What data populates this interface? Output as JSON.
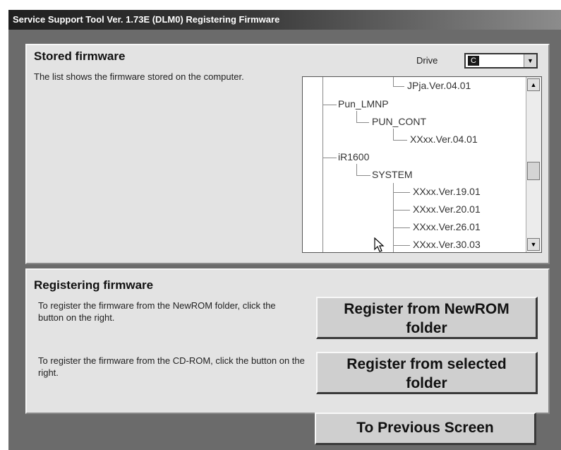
{
  "window": {
    "title": "Service Support Tool Ver. 1.73E (DLM0)   Registering Firmware"
  },
  "stored": {
    "heading": "Stored firmware",
    "description": "The list shows the firmware stored on the computer.",
    "drive_label": "Drive",
    "drive_value": "C"
  },
  "tree": {
    "nodes": [
      "JPja.Ver.04.01",
      "Pun_LMNP",
      "PUN_CONT",
      "XXxx.Ver.04.01",
      "iR1600",
      "SYSTEM",
      "XXxx.Ver.19.01",
      "XXxx.Ver.20.01",
      "XXxx.Ver.26.01",
      "XXxx.Ver.30.03"
    ]
  },
  "registering": {
    "heading": "Registering firmware",
    "desc_newrom": "To register the firmware from the NewROM folder, click the button on the right.",
    "desc_cdrom": "To register the firmware from the CD-ROM, click the button on the right.",
    "btn_newrom_line1": "Register from NewROM",
    "btn_newrom_line2": "folder",
    "btn_selected_line1": "Register from selected",
    "btn_selected_line2": "folder"
  },
  "footer": {
    "previous_label": "To Previous Screen"
  },
  "icons": {
    "scroll_up": "scroll-up-arrow-icon",
    "scroll_down": "scroll-down-arrow-icon",
    "dropdown": "chevron-down-icon",
    "cursor": "mouse-pointer-icon"
  }
}
